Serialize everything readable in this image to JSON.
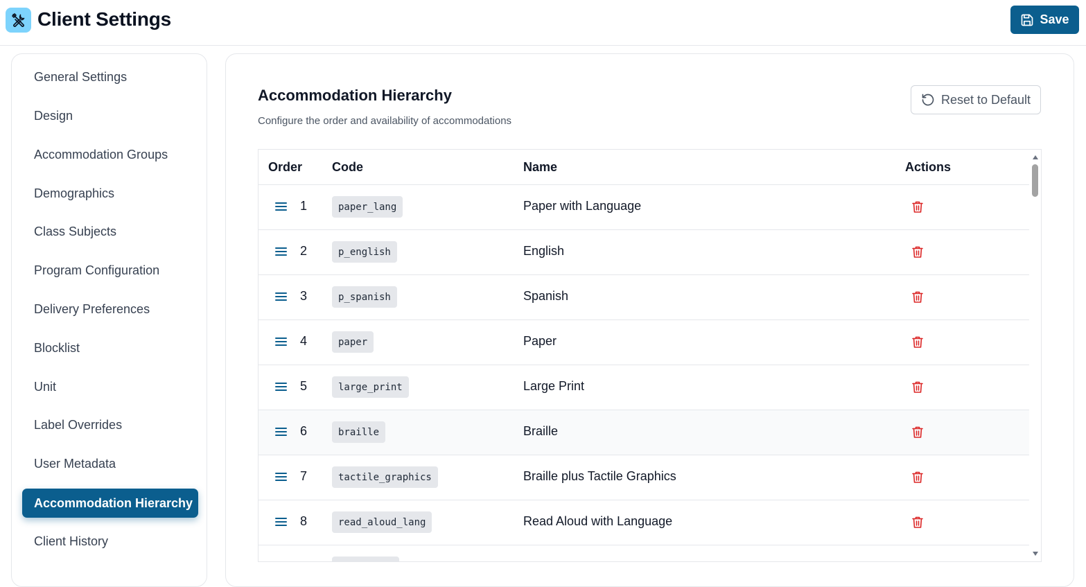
{
  "header": {
    "title": "Client Settings",
    "save_label": "Save",
    "accent": "#0b5e8e",
    "logo_bg": "#7dd3fc"
  },
  "sidebar": {
    "items": [
      {
        "label": "General Settings",
        "icon": "none"
      },
      {
        "label": "Design"
      },
      {
        "label": "Accommodation Groups"
      },
      {
        "label": "Demographics"
      },
      {
        "label": "Class Subjects"
      },
      {
        "label": "Program Configuration"
      },
      {
        "label": "Delivery Preferences"
      },
      {
        "label": "Blocklist"
      },
      {
        "label": "Unit"
      },
      {
        "label": "Label Overrides"
      },
      {
        "label": "User Metadata"
      },
      {
        "label": "Accommodation Hierarchy",
        "active": true
      },
      {
        "label": "Client History"
      }
    ]
  },
  "main": {
    "title": "Accommodation Hierarchy",
    "subtitle": "Configure the order and availability of accommodations",
    "reset_label": "Reset to Default"
  },
  "table": {
    "headers": {
      "order": "Order",
      "code": "Code",
      "name": "Name",
      "actions": "Actions"
    },
    "rows": [
      {
        "order": "1",
        "code": "paper_lang",
        "name": "Paper with Language"
      },
      {
        "order": "2",
        "code": "p_english",
        "name": "English"
      },
      {
        "order": "3",
        "code": "p_spanish",
        "name": "Spanish"
      },
      {
        "order": "4",
        "code": "paper",
        "name": "Paper"
      },
      {
        "order": "5",
        "code": "large_print",
        "name": "Large Print"
      },
      {
        "order": "6",
        "code": "braille",
        "name": "Braille"
      },
      {
        "order": "7",
        "code": "tactile_graphics",
        "name": "Braille plus Tactile Graphics"
      },
      {
        "order": "8",
        "code": "read_aloud_lang",
        "name": "Read Aloud with Language"
      }
    ],
    "delete_color": "#dc2626"
  }
}
